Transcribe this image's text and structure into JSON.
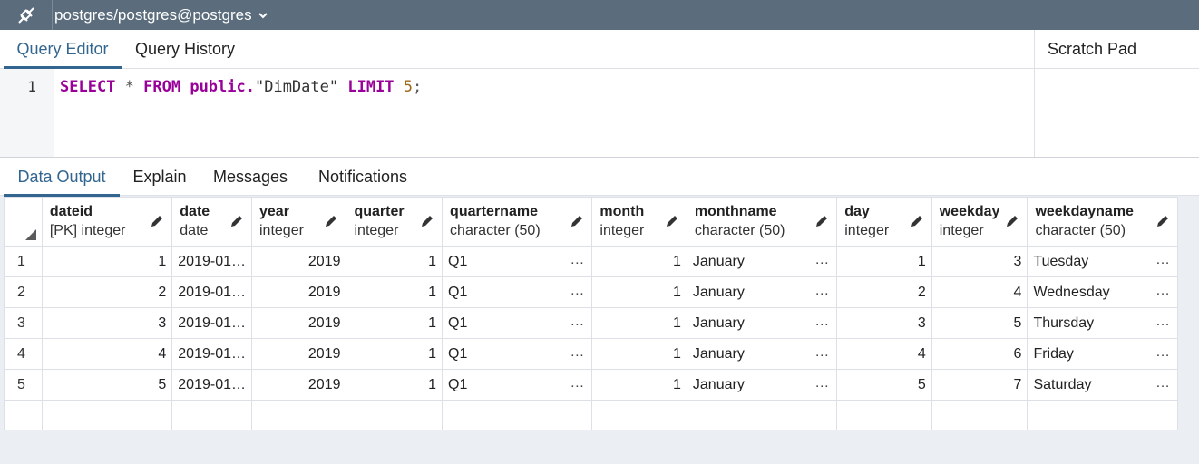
{
  "topbar": {
    "connection": "postgres/postgres@postgres"
  },
  "editor_tabs": [
    "Query Editor",
    "Query History"
  ],
  "scratch_pad": "Scratch Pad",
  "editor": {
    "line_number": "1",
    "tokens": [
      "SELECT",
      " * ",
      "FROM",
      " public.",
      "\"DimDate\"",
      " ",
      "LIMIT",
      " ",
      "5",
      ";"
    ]
  },
  "result_tabs": [
    "Data Output",
    "Explain",
    "Messages",
    "Notifications"
  ],
  "columns": [
    {
      "name": "dateid",
      "type": "[PK] integer"
    },
    {
      "name": "date",
      "type": "date"
    },
    {
      "name": "year",
      "type": "integer"
    },
    {
      "name": "quarter",
      "type": "integer"
    },
    {
      "name": "quartername",
      "type": "character (50)"
    },
    {
      "name": "month",
      "type": "integer"
    },
    {
      "name": "monthname",
      "type": "character (50)"
    },
    {
      "name": "day",
      "type": "integer"
    },
    {
      "name": "weekday",
      "type": "integer"
    },
    {
      "name": "weekdayname",
      "type": "character (50)"
    }
  ],
  "rows": [
    {
      "n": "1",
      "dateid": "1",
      "date": "2019-01…",
      "year": "2019",
      "quarter": "1",
      "quartername": "Q1",
      "month": "1",
      "monthname": "January",
      "day": "1",
      "weekday": "3",
      "weekdayname": "Tuesday"
    },
    {
      "n": "2",
      "dateid": "2",
      "date": "2019-01…",
      "year": "2019",
      "quarter": "1",
      "quartername": "Q1",
      "month": "1",
      "monthname": "January",
      "day": "2",
      "weekday": "4",
      "weekdayname": "Wednesday"
    },
    {
      "n": "3",
      "dateid": "3",
      "date": "2019-01…",
      "year": "2019",
      "quarter": "1",
      "quartername": "Q1",
      "month": "1",
      "monthname": "January",
      "day": "3",
      "weekday": "5",
      "weekdayname": "Thursday"
    },
    {
      "n": "4",
      "dateid": "4",
      "date": "2019-01…",
      "year": "2019",
      "quarter": "1",
      "quartername": "Q1",
      "month": "1",
      "monthname": "January",
      "day": "4",
      "weekday": "6",
      "weekdayname": "Friday"
    },
    {
      "n": "5",
      "dateid": "5",
      "date": "2019-01…",
      "year": "2019",
      "quarter": "1",
      "quartername": "Q1",
      "month": "1",
      "monthname": "January",
      "day": "5",
      "weekday": "7",
      "weekdayname": "Saturday"
    }
  ],
  "ellipsis": "…",
  "icons": {
    "connection": "plug-icon",
    "dropdown": "chevron-down-icon",
    "edit": "pencil-icon",
    "corner": "select-all-triangle-icon"
  },
  "colors": {
    "topbar": "#5b6d7c",
    "active_tab": "#326690",
    "keyword": "#990099",
    "number": "#a06a1a"
  }
}
